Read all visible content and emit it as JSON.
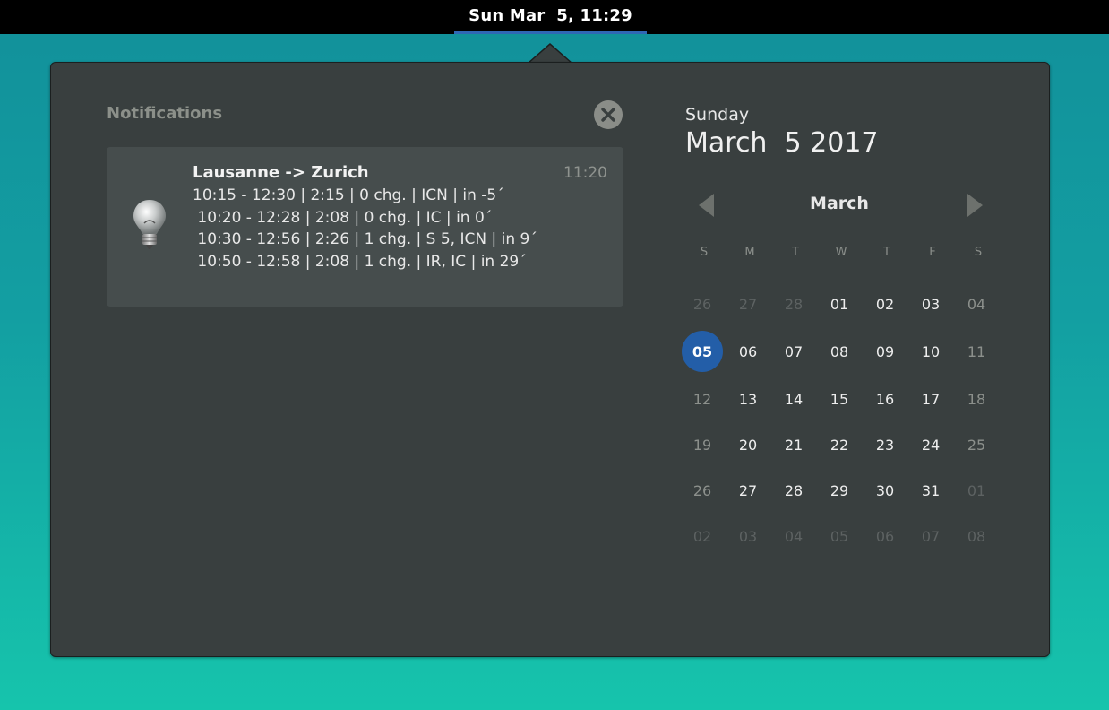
{
  "topbar": {
    "clock": "Sun Mar  5, 11:29"
  },
  "notifications": {
    "title": "Notifications",
    "clear_icon": "close-circle-icon",
    "items": [
      {
        "icon": "lightbulb-icon",
        "title": "Lausanne -> Zurich",
        "time": "11:20",
        "lines": [
          "10:15 - 12:30 | 2:15 | 0 chg. | ICN | in -5´",
          " 10:20 - 12:28 | 2:08 | 0 chg. | IC | in 0´",
          " 10:30 - 12:56 | 2:26 | 1 chg. | S 5, ICN | in 9´",
          " 10:50 - 12:58 | 2:08 | 1 chg. | IR, IC | in 29´"
        ]
      }
    ]
  },
  "calendar": {
    "weekday": "Sunday",
    "full_date": "March  5 2017",
    "month": "March",
    "prev_icon": "triangle-left-icon",
    "next_icon": "triangle-right-icon",
    "day_headers": [
      "S",
      "M",
      "T",
      "W",
      "T",
      "F",
      "S"
    ],
    "weeks": [
      [
        "26",
        "27",
        "28",
        "01",
        "02",
        "03",
        "04"
      ],
      [
        "05",
        "06",
        "07",
        "08",
        "09",
        "10",
        "11"
      ],
      [
        "12",
        "13",
        "14",
        "15",
        "16",
        "17",
        "18"
      ],
      [
        "19",
        "20",
        "21",
        "22",
        "23",
        "24",
        "25"
      ],
      [
        "26",
        "27",
        "28",
        "29",
        "30",
        "31",
        "01"
      ],
      [
        "02",
        "03",
        "04",
        "05",
        "06",
        "07",
        "08"
      ]
    ],
    "other_month": [
      [
        true,
        true,
        true,
        false,
        false,
        false,
        false
      ],
      [
        false,
        false,
        false,
        false,
        false,
        false,
        false
      ],
      [
        false,
        false,
        false,
        false,
        false,
        false,
        false
      ],
      [
        false,
        false,
        false,
        false,
        false,
        false,
        false
      ],
      [
        false,
        false,
        false,
        false,
        false,
        false,
        true
      ],
      [
        true,
        true,
        true,
        true,
        true,
        true,
        true
      ]
    ],
    "today": "05",
    "colors": {
      "accent": "#235ea8",
      "panel": "#393f3f",
      "card": "#464d4d"
    }
  }
}
